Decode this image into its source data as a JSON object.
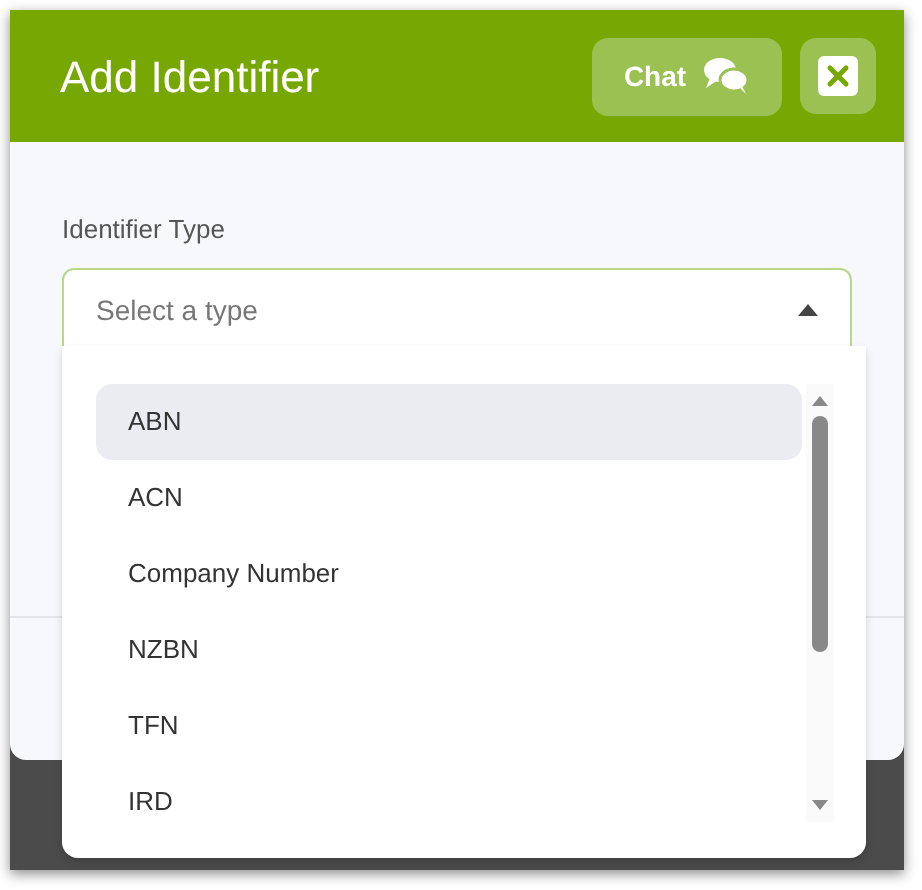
{
  "dialog": {
    "title": "Add Identifier",
    "chat_button": "Chat"
  },
  "field": {
    "label": "Identifier Type",
    "placeholder": "Select a type",
    "expanded": true
  },
  "options": [
    {
      "label": "ABN",
      "selected": true
    },
    {
      "label": "ACN",
      "selected": false
    },
    {
      "label": "Company Number",
      "selected": false
    },
    {
      "label": "NZBN",
      "selected": false
    },
    {
      "label": "TFN",
      "selected": false
    },
    {
      "label": "IRD",
      "selected": false
    }
  ]
}
